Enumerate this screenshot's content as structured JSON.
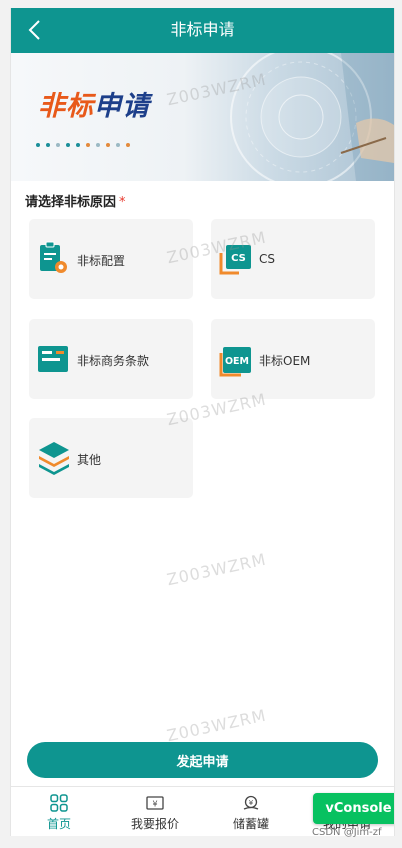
{
  "header": {
    "title": "非标申请"
  },
  "banner": {
    "title_part1": "非标",
    "title_part2": "申请"
  },
  "form": {
    "label": "请选择非标原因",
    "required_mark": "*",
    "options": [
      {
        "label": "非标配置",
        "icon": "config-clipboard-icon"
      },
      {
        "label": "CS",
        "icon": "cs-badge-icon",
        "badge": "CS"
      },
      {
        "label": "非标商务条款",
        "icon": "business-terms-icon"
      },
      {
        "label": "非标OEM",
        "icon": "oem-badge-icon",
        "badge": "OEM"
      },
      {
        "label": "其他",
        "icon": "layers-icon"
      }
    ]
  },
  "submit_label": "发起申请",
  "tabbar": {
    "items": [
      {
        "label": "首页",
        "icon": "grid-home-icon",
        "active": true
      },
      {
        "label": "我要报价",
        "icon": "quote-icon",
        "active": false
      },
      {
        "label": "储蓄罐",
        "icon": "piggy-bank-icon",
        "active": false
      },
      {
        "label": "我的申请",
        "icon": "my-apply-icon",
        "active": false
      }
    ]
  },
  "vconsole_label": "vConsole",
  "watermark": "Z003WZRM",
  "footer_credit": "CSDN @Jim-zf",
  "colors": {
    "primary": "#0e9590",
    "accent_orange": "#e8591a",
    "vconsole_green": "#07c160"
  }
}
